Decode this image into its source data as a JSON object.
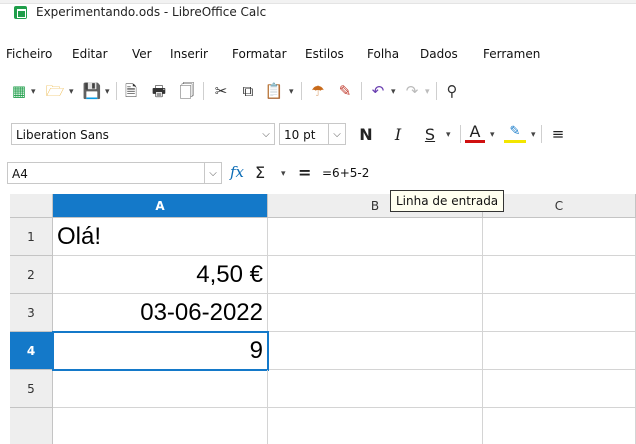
{
  "window": {
    "title": "Experimentando.ods - LibreOffice Calc"
  },
  "menu": {
    "items": [
      "Ficheiro",
      "Editar",
      "Ver",
      "Inserir",
      "Formatar",
      "Estilos",
      "Folha",
      "Dados",
      "Ferramen"
    ]
  },
  "formatting": {
    "font_name": "Liberation Sans",
    "font_size": "10 pt",
    "bold_label": "N",
    "italic_label": "I",
    "underline_label": "S",
    "font_color_label": "A"
  },
  "formula_bar": {
    "name_box": "A4",
    "formula": "=6+5-2",
    "tooltip": "Linha de entrada"
  },
  "sheet": {
    "columns": [
      "A",
      "B",
      "C"
    ],
    "active_column": "A",
    "rows": [
      "1",
      "2",
      "3",
      "4",
      "5"
    ],
    "active_row": "4",
    "cells": {
      "A1": "Olá!",
      "A2": "4,50 €",
      "A3": "03-06-2022",
      "A4": "9"
    }
  },
  "colors": {
    "accent": "#1479c9",
    "calc_green": "#1f9e4a",
    "fx_blue": "#0a6bb5"
  },
  "icons": {
    "toolbar": [
      "new-spreadsheet-icon",
      "open-folder-icon",
      "save-icon",
      "export-pdf-icon",
      "print-icon",
      "print-preview-icon",
      "cut-icon",
      "copy-icon",
      "paste-icon",
      "clone-formatting-icon",
      "clear-formatting-icon",
      "undo-icon",
      "redo-icon",
      "find-icon"
    ]
  }
}
